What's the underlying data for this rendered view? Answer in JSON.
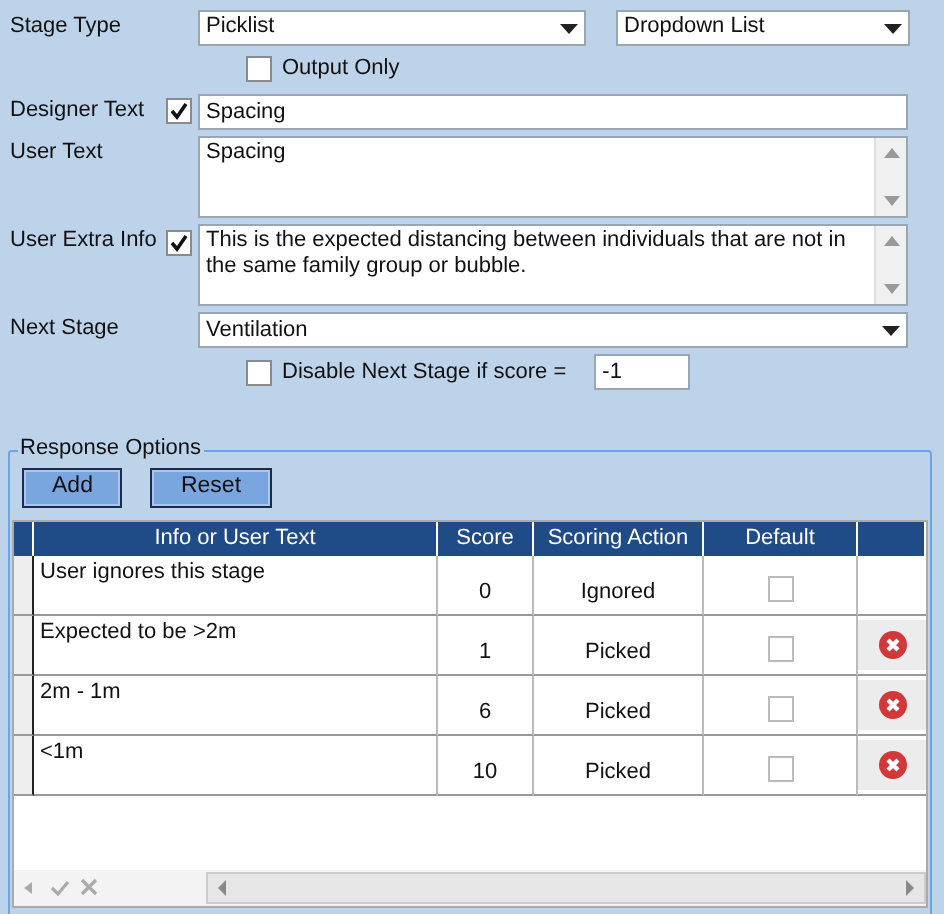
{
  "stage_type": {
    "label": "Stage Type",
    "value": "Picklist",
    "display": "Dropdown List"
  },
  "output_only": {
    "label": "Output Only",
    "checked": false
  },
  "designer_text": {
    "label": "Designer Text",
    "checked": true,
    "value": "Spacing"
  },
  "user_text": {
    "label": "User Text",
    "value": "Spacing"
  },
  "user_extra_info": {
    "label": "User Extra Info",
    "checked": true,
    "value": "This is the expected distancing between individuals that are not in the same family group or bubble."
  },
  "next_stage": {
    "label": "Next Stage",
    "value": "Ventilation"
  },
  "disable_next": {
    "label": "Disable Next Stage if score =",
    "checked": false,
    "value": "-1"
  },
  "response_options": {
    "title": "Response Options",
    "buttons": [
      "Add",
      "Reset"
    ],
    "columns": [
      "Info or User Text",
      "Score",
      "Scoring Action",
      "Default"
    ],
    "rows": [
      {
        "text": "User ignores this stage",
        "score": "0",
        "action": "Ignored",
        "default": false,
        "deletable": false
      },
      {
        "text": "Expected to be >2m",
        "score": "1",
        "action": "Picked",
        "default": false,
        "deletable": true
      },
      {
        "text": "2m - 1m",
        "score": "6",
        "action": "Picked",
        "default": false,
        "deletable": true
      },
      {
        "text": "<1m",
        "score": "10",
        "action": "Picked",
        "default": false,
        "deletable": true
      }
    ]
  }
}
